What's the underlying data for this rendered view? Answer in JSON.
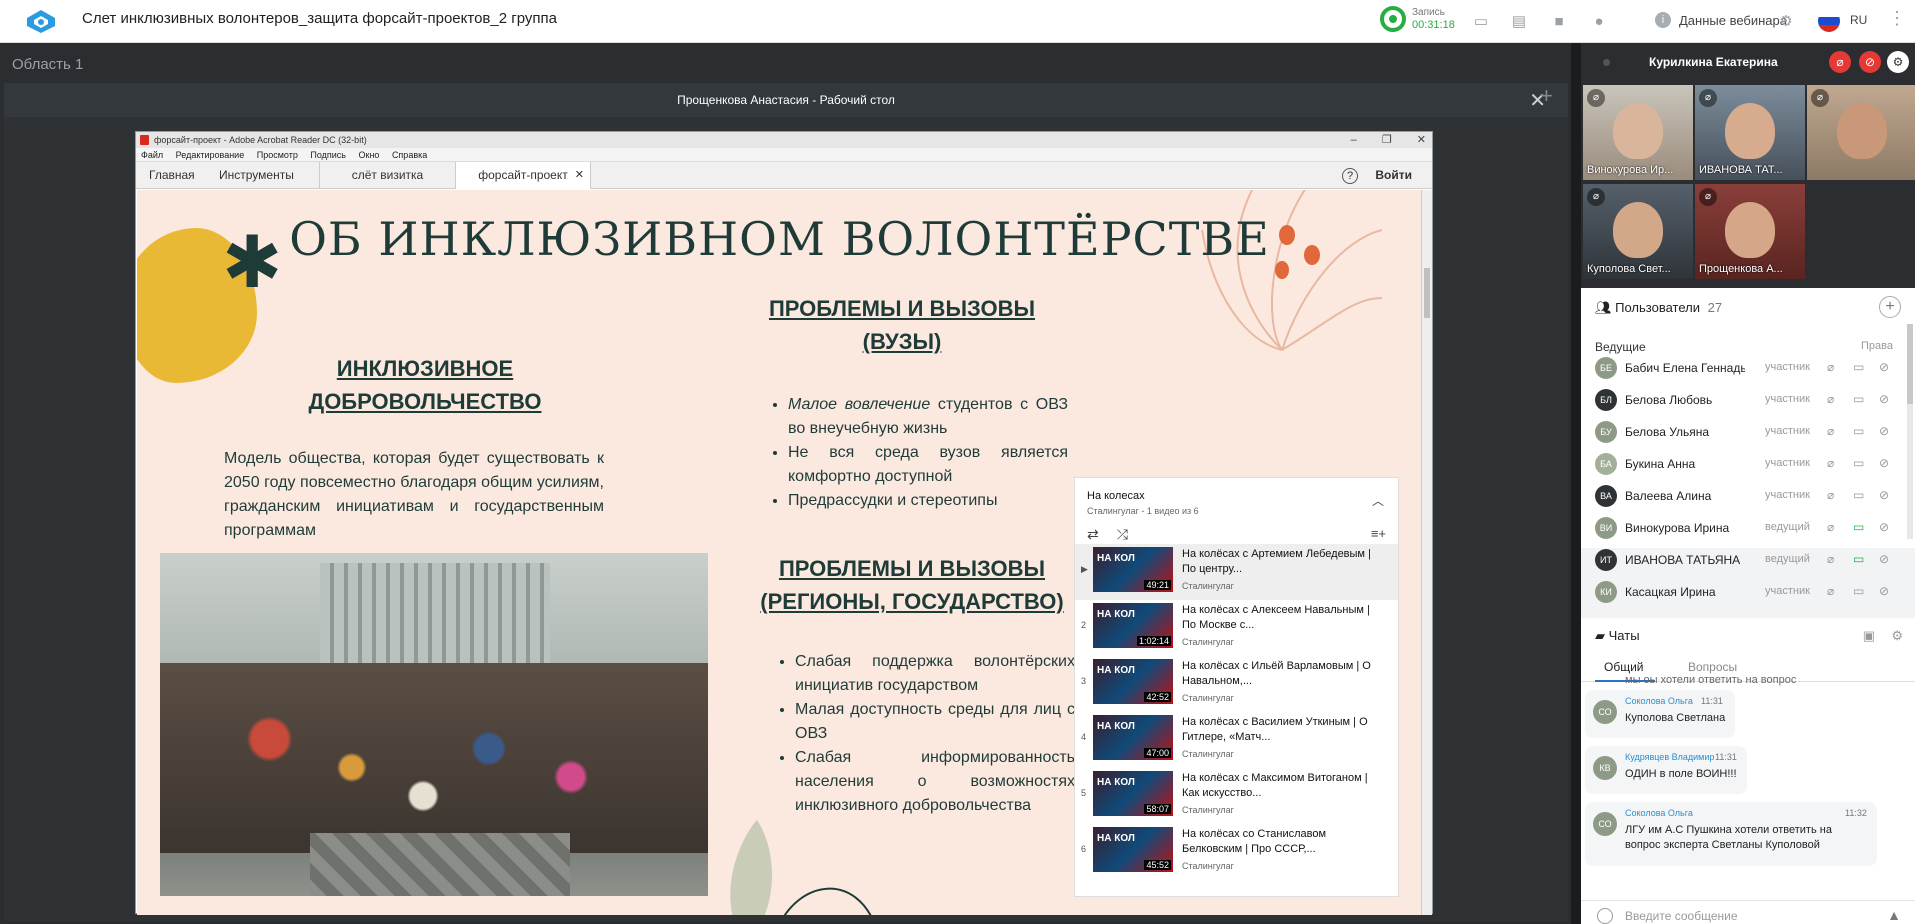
{
  "app": {
    "title": "Слет инклюзивных волонтеров_защита форсайт-проектов_2 группа",
    "recording_label": "Запись",
    "recording_time": "00:31:18",
    "webinar_data": "Данные вебинара",
    "language": "RU",
    "area_label": "Область 1"
  },
  "share": {
    "title": "Прощенкова Анастасия - Рабочий стол"
  },
  "acrobat": {
    "window_title": "форсайт-проект - Adobe Acrobat Reader DC (32-bit)",
    "menu": [
      "Файл",
      "Редактирование",
      "Просмотр",
      "Подпись",
      "Окно",
      "Справка"
    ],
    "tab_home": "Главная",
    "tab_tools": "Инструменты",
    "tab_visit": "слёт визитка",
    "tab_foresight": "форсайт-проект",
    "login": "Войти"
  },
  "slide": {
    "title": "ОБ ИНКЛЮЗИВНОМ ВОЛОНТЁРСТВЕ",
    "h_inclusive_1": "ИНКЛЮЗИВНОЕ",
    "h_inclusive_2": "ДОБРОВОЛЬЧЕСТВО",
    "model_text": "Модель общества, которая будет существовать к 2050 году повсеместно благодаря общим усилиям, гражданским инициативам и государственным программам",
    "h_prob1_1": "ПРОБЛЕМЫ И ВЫЗОВЫ",
    "h_prob1_2": "(ВУЗЫ)",
    "list1_item1_em": "Малое вовлечение",
    "list1_item1_rest": " студентов с ОВЗ во внеучебную жизнь",
    "list1_item2": "Не вся среда вузов является комфортно доступной",
    "list1_item3": "Предрассудки и стереотипы",
    "h_prob2_1": "ПРОБЛЕМЫ И ВЫЗОВЫ",
    "h_prob2_2": "(РЕГИОНЫ, ГОСУДАРСТВО)",
    "list2_item1": "Слабая поддержка волонтёрских инициатив государством",
    "list2_item2": "Малая доступность среды для лиц с ОВЗ",
    "list2_item3": "Слабая информированность населения о возможностях инклюзивного добровольчества"
  },
  "playlist": {
    "title": "На колесах",
    "subtitle": "Сталингулаг - 1 видео из 6",
    "items": [
      {
        "num": "▶",
        "name": "На колёсах с Артемием Лебедевым | По центру...",
        "channel": "Сталингулаг",
        "duration": "49:21"
      },
      {
        "num": "2",
        "name": "На колёсах с Алексеем Навальным | По Москве с...",
        "channel": "Сталингулаг",
        "duration": "1:02:14"
      },
      {
        "num": "3",
        "name": "На колёсах с Ильёй Варламовым | О Навальном,...",
        "channel": "Сталингулаг",
        "duration": "42:52"
      },
      {
        "num": "4",
        "name": "На колёсах с Василием Уткиным | О Гитлере, «Матч...",
        "channel": "Сталингулаг",
        "duration": "47:00"
      },
      {
        "num": "5",
        "name": "На колёсах с Максимом Витоганом | Как искусство...",
        "channel": "Сталингулаг",
        "duration": "58:07"
      },
      {
        "num": "6",
        "name": "На колёсах со Станиславом Белковским | Про СССР,...",
        "channel": "Сталингулаг",
        "duration": "45:52"
      }
    ],
    "thumb_text": "НА КОЛ"
  },
  "right_panel": {
    "host_name": "Курилкина Екатерина",
    "tiles": [
      {
        "label": "Винокурова Ир..."
      },
      {
        "label": "ИВАНОВА ТАТ..."
      },
      {
        "label": ""
      },
      {
        "label": "Куполова Свет..."
      },
      {
        "label": "Прощенкова А..."
      }
    ],
    "users_label": "Пользователи",
    "users_count": "27",
    "lead_label": "Ведущие",
    "rights_label": "Права",
    "users": [
      {
        "initials": "БЕ",
        "name": "Бабич Елена Геннадь...",
        "role": "участник",
        "color": "#8c9a86"
      },
      {
        "initials": "БЛ",
        "name": "Белова Любовь",
        "role": "участник",
        "color": "#2f3336"
      },
      {
        "initials": "БУ",
        "name": "Белова Ульяна",
        "role": "участник",
        "color": "#8c9a86"
      },
      {
        "initials": "БА",
        "name": "Букина Анна",
        "role": "участник",
        "color": "#a2b09a"
      },
      {
        "initials": "ВА",
        "name": "Валеева Алина",
        "role": "участник",
        "color": "#2f3336"
      },
      {
        "initials": "ВИ",
        "name": "Винокурова Ирина",
        "role": "ведущий",
        "color": "#8c9a86"
      },
      {
        "initials": "ИТ",
        "name": "ИВАНОВА ТАТЬЯНА",
        "role": "ведущий",
        "color": "#2f3336"
      },
      {
        "initials": "КИ",
        "name": "Касацкая Ирина",
        "role": "участник",
        "color": "#8c9a86"
      }
    ],
    "chats_label": "Чаты",
    "tab_all": "Общий",
    "tab_questions": "Вопросы",
    "cut_message": "мы оы хотели ответить на вопрос",
    "messages": [
      {
        "initials": "СО",
        "author": "Соколова Ольга",
        "time": "11:31",
        "text": "Куполова Светлана"
      },
      {
        "initials": "КВ",
        "author": "Кудрявцев Владимир",
        "time": "11:31",
        "text": "ОДИН в поле ВОИН!!!"
      },
      {
        "initials": "СО",
        "author": "Соколова Ольга",
        "time": "11:32",
        "text": "ЛГУ им А.С Пушкина хотели ответить на вопрос эксперта Светланы Куполовой"
      }
    ],
    "input_placeholder": "Введите сообщение"
  }
}
